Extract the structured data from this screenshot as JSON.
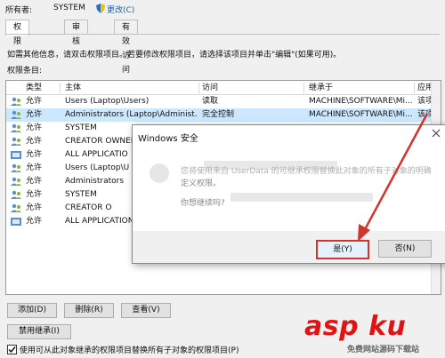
{
  "owner": {
    "label": "所有者:",
    "value": "SYSTEM",
    "change_link": "更改(C)"
  },
  "tabs": [
    {
      "label": "权限",
      "active": true
    },
    {
      "label": "审核",
      "active": false
    },
    {
      "label": "有效访问",
      "active": false
    }
  ],
  "info_text": "如需其他信息，请双击权限项目。若要修改权限项目，请选择该项目并单击\"编辑\"(如果可用)。",
  "entries_label": "权限条目:",
  "table": {
    "columns": [
      "类型",
      "主体",
      "访问",
      "继承于",
      "应用于"
    ],
    "rows": [
      {
        "type": "允许",
        "principal": "Users (Laptop\\Users)",
        "access": "读取",
        "inherited": "MACHINE\\SOFTWARE\\Mi...",
        "applies": "该项及其"
      },
      {
        "type": "允许",
        "principal": "Administrators (Laptop\\Administ...",
        "access": "完全控制",
        "inherited": "MACHINE\\SOFTWARE\\Mi...",
        "applies": "该项及其"
      },
      {
        "type": "允许",
        "principal": "SYSTEM",
        "access": "",
        "inherited": "",
        "applies": ""
      },
      {
        "type": "允许",
        "principal": "CREATOR OWNER",
        "access": "",
        "inherited": "",
        "applies": ""
      },
      {
        "type": "允许",
        "principal": "ALL APPLICATIO",
        "access": "",
        "inherited": "",
        "applies": ""
      },
      {
        "type": "允许",
        "principal": "Users (Laptop\\U",
        "access": "",
        "inherited": "",
        "applies": ""
      },
      {
        "type": "允许",
        "principal": "Administrators",
        "access": "",
        "inherited": "",
        "applies": ""
      },
      {
        "type": "允许",
        "principal": "SYSTEM",
        "access": "",
        "inherited": "",
        "applies": ""
      },
      {
        "type": "允许",
        "principal": "CREATOR O",
        "access": "",
        "inherited": "",
        "applies": ""
      },
      {
        "type": "允许",
        "principal": "ALL APPLICATION",
        "access": "",
        "inherited": "",
        "applies": ""
      }
    ]
  },
  "buttons": {
    "add": "添加(D)",
    "remove": "删除(R)",
    "view": "查看(V)",
    "disable_inheritance": "禁用继承(I)"
  },
  "checkbox_label": "使用可从此对象继承的权限项目替换所有子对象的权限项目(P)",
  "dialog": {
    "title": "Windows 安全",
    "body_line1": "您将使用来自 UserData 的可继承权限替换此对象的所有子对象的明确",
    "body_line2": "定义权限。",
    "body_line3": "你想继续吗?",
    "yes": "是(Y)",
    "no": "否(N)"
  },
  "watermark": {
    "brand": "asp ku",
    "subtitle": "免费网站源码下载站"
  },
  "colors": {
    "accent": "#1a5fb4",
    "selection": "#cce8ff",
    "highlight": "#d0342c"
  }
}
